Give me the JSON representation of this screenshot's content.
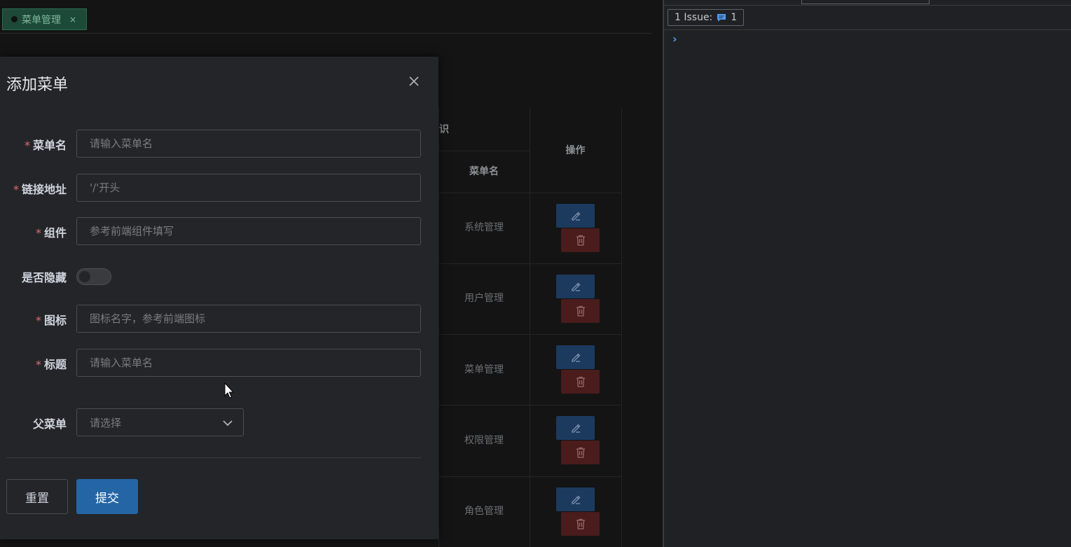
{
  "tabs": [
    {
      "label": "菜单管理",
      "close": "×"
    }
  ],
  "table": {
    "group_header_fragment": "识",
    "col_menu_name": "菜单名",
    "col_actions": "操作",
    "rows": [
      {
        "menu_name": "系统管理"
      },
      {
        "menu_name": "用户管理"
      },
      {
        "menu_name": "菜单管理"
      },
      {
        "menu_name": "权限管理"
      },
      {
        "menu_name": "角色管理"
      }
    ]
  },
  "dialog": {
    "title": "添加菜单",
    "fields": {
      "menu_name": {
        "label": "菜单名",
        "required": "*",
        "placeholder": "请输入菜单名",
        "value": ""
      },
      "link": {
        "label": "链接地址",
        "required": "*",
        "placeholder": "'/'开头",
        "value": ""
      },
      "component": {
        "label": "组件",
        "required": "*",
        "placeholder": "参考前端组件填写",
        "value": ""
      },
      "hidden": {
        "label": "是否隐藏",
        "checked": false
      },
      "icon": {
        "label": "图标",
        "required": "*",
        "placeholder": "图标名字，参考前端图标",
        "value": ""
      },
      "title": {
        "label": "标题",
        "required": "*",
        "placeholder": "请输入菜单名",
        "value": ""
      },
      "parent": {
        "label": "父菜单",
        "placeholder": "请选择"
      }
    },
    "reset_label": "重置",
    "submit_label": "提交"
  },
  "devtools": {
    "issues_label": "1 Issue:",
    "issues_count": "1",
    "prompt_symbol": "›"
  },
  "colors": {
    "primary": "#2465a6",
    "danger": "#4a1c1c",
    "required": "#e56a6a",
    "tab_active": "#1d4a38"
  }
}
